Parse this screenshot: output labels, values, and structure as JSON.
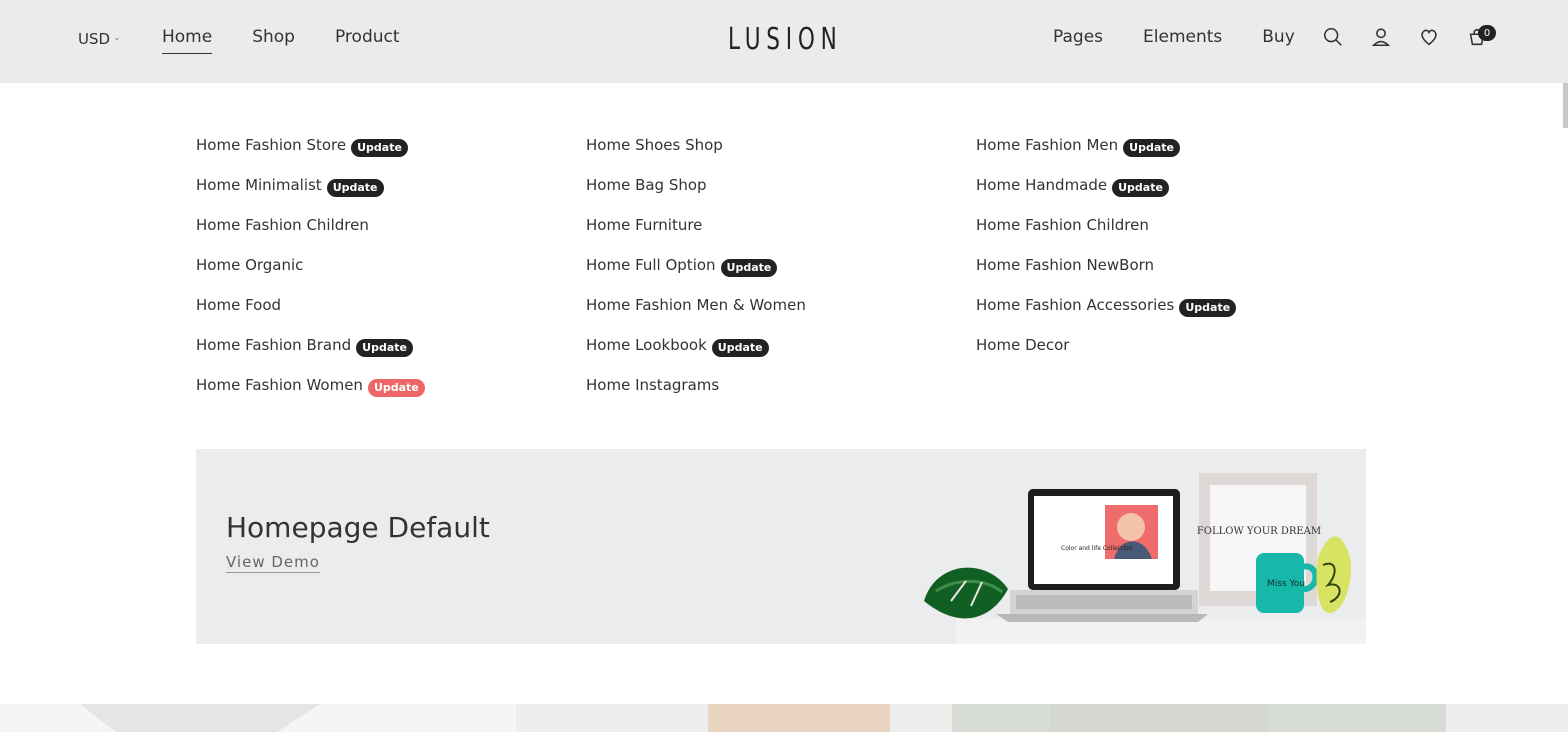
{
  "header": {
    "currency": "USD",
    "nav_left": [
      "Home",
      "Shop",
      "Product"
    ],
    "logo": "LUSION",
    "nav_right": [
      "Pages",
      "Elements",
      "Buy"
    ],
    "cart_count": "0"
  },
  "mega_menu": {
    "columns": [
      [
        {
          "label": "Home Fashion Store",
          "badge": "Update",
          "badge_color": "#222222"
        },
        {
          "label": "Home Minimalist",
          "badge": "Update",
          "badge_color": "#222222"
        },
        {
          "label": "Home Fashion Children"
        },
        {
          "label": "Home Organic"
        },
        {
          "label": "Home Food"
        },
        {
          "label": "Home Fashion Brand",
          "badge": "Update",
          "badge_color": "#222222"
        },
        {
          "label": "Home Fashion Women",
          "badge": "Update",
          "badge_color": "#ed6766"
        }
      ],
      [
        {
          "label": "Home Shoes Shop"
        },
        {
          "label": "Home Bag Shop"
        },
        {
          "label": "Home Furniture"
        },
        {
          "label": "Home Full Option",
          "badge": "Update",
          "badge_color": "#222222"
        },
        {
          "label": "Home Fashion Men & Women"
        },
        {
          "label": "Home Lookbook",
          "badge": "Update",
          "badge_color": "#222222"
        },
        {
          "label": "Home Instagrams"
        }
      ],
      [
        {
          "label": "Home Fashion Men",
          "badge": "Update",
          "badge_color": "#222222"
        },
        {
          "label": "Home Handmade",
          "badge": "Update",
          "badge_color": "#222222"
        },
        {
          "label": "Home Fashion Children"
        },
        {
          "label": "Home Fashion NewBorn"
        },
        {
          "label": "Home Fashion Accessories",
          "badge": "Update",
          "badge_color": "#222222"
        },
        {
          "label": "Home Decor"
        }
      ]
    ]
  },
  "banner": {
    "title": "Homepage Default",
    "link": "View Demo",
    "laptop_screen_text": "Color and life Collection",
    "frame_text": "FOLLOW YOUR DREAM",
    "mug_text": "Miss You"
  },
  "icons": [
    "search-icon",
    "user-icon",
    "heart-icon",
    "cart-icon"
  ],
  "colors": {
    "header_bg": "#ebebed",
    "badge_dark": "#222222",
    "badge_red": "#ed6766",
    "banner_bg": "#ebecee"
  }
}
